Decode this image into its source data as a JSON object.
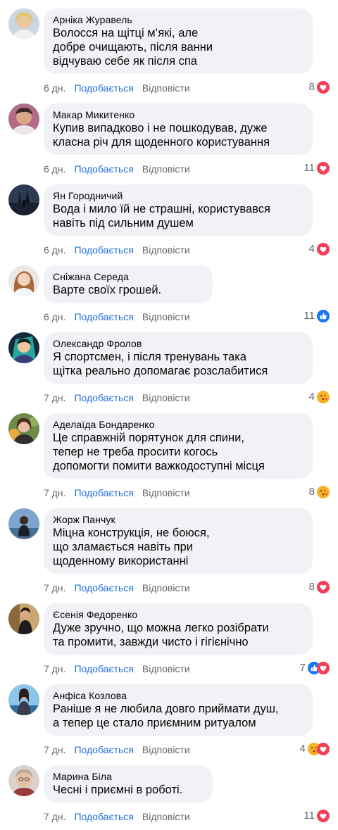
{
  "actions": {
    "like_label": "Подобається",
    "reply_label": "Відповісти"
  },
  "colors": {
    "bubble": "#f0f2f5",
    "like_link": "#216fdb",
    "muted_text": "#65676b",
    "heart": "#f33e58",
    "like": "#1877f2",
    "haha": "#f7b125"
  },
  "comments": [
    {
      "author": "Арніка Журавель",
      "lines": [
        "Волосся на щітці м’які, але",
        "добре очищають, після ванни",
        "відчуваю себе як після спа"
      ],
      "time": "6 дн.",
      "reaction_count": "8",
      "reactions": [
        "heart-reaction-icon"
      ]
    },
    {
      "author": "Макар Микитенко",
      "lines": [
        "Купив випадково і не пошкодував, дуже",
        "класна річ для щоденного користування"
      ],
      "time": "6 дн.",
      "reaction_count": "11",
      "reactions": [
        "heart-reaction-icon"
      ]
    },
    {
      "author": "Ян Городничий",
      "lines": [
        "Вода і мило їй не страшні, користувався",
        "навіть під сильним душем"
      ],
      "time": "6 дн.",
      "reaction_count": "4",
      "reactions": [
        "heart-reaction-icon"
      ]
    },
    {
      "author": "Сніжана Середа",
      "lines": [
        "Варте своїх грошей."
      ],
      "time": "6 дн.",
      "reaction_count": "11",
      "reactions": [
        "like-reaction-icon"
      ]
    },
    {
      "author": "Олександр Фролов",
      "lines": [
        "Я спортсмен, і після тренувань така",
        "щітка реально допомагає розслабитися"
      ],
      "time": "7 дн.",
      "reaction_count": "4",
      "reactions": [
        "kiss-reaction-icon"
      ]
    },
    {
      "author": "Аделаїда Бондаренко",
      "lines": [
        "Це справжній порятунок для спини,",
        "тепер не треба просити когось",
        "допомогти помити важкодоступні місця"
      ],
      "time": "7 дн.",
      "reaction_count": "8",
      "reactions": [
        "kiss-reaction-icon"
      ]
    },
    {
      "author": "Жорж Панчук",
      "lines": [
        "Міцна конструкція, не боюся,",
        "що зламається навіть при",
        "щоденному використанні"
      ],
      "time": "7 дн.",
      "reaction_count": "8",
      "reactions": [
        "heart-reaction-icon"
      ]
    },
    {
      "author": "Єсенія Федоренко",
      "lines": [
        "Дуже зручно, що можна легко розібрати",
        "та промити, завжди чисто і гігієнічно"
      ],
      "time": "7 дн.",
      "reaction_count": "7",
      "reactions": [
        "like-reaction-icon",
        "heart-reaction-icon"
      ]
    },
    {
      "author": "Анфіса Козлова",
      "lines": [
        "Раніше я не любила довго приймати душ,",
        "а тепер це стало приємним ритуалом"
      ],
      "time": "7 дн.",
      "reaction_count": "4",
      "reactions": [
        "kiss-reaction-icon",
        "heart-reaction-icon"
      ]
    },
    {
      "author": "Марина Біла",
      "lines": [
        "Чесні і приємні в роботі."
      ],
      "time": "7 дн.",
      "reaction_count": "11",
      "reactions": [
        "heart-reaction-icon"
      ]
    }
  ]
}
